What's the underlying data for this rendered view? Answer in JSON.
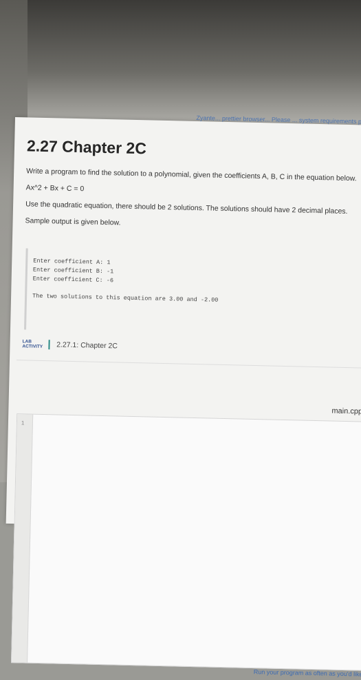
{
  "banner": "Zyante... prettier browser... Please ... system requirements page for ...",
  "section_title": "2.27 Chapter 2C",
  "intro": "Write a program to find the solution to a polynomial, given the coefficients A, B, C in the equation below.",
  "equation": "Ax^2 + Bx + C = 0",
  "instruction": "Use the quadratic equation, there should be 2 solutions. The solutions should have 2 decimal places.",
  "sample_label": "Sample output is given below.",
  "sample_output": {
    "line1": "Enter coefficient A: 1",
    "line2": "Enter coefficient B: -1",
    "line3": "Enter coefficient C: -6",
    "line4": "The two solutions to this equation are 3.00 and -2.00"
  },
  "lab": {
    "tag_line1": "LAB",
    "tag_line2": "ACTIVITY",
    "title": "2.27.1: Chapter 2C"
  },
  "editor": {
    "filename": "main.cpp",
    "line_number": "1"
  },
  "footer_hint": "Run your program as often as you'd like, before submitting for grading. Below, ..."
}
